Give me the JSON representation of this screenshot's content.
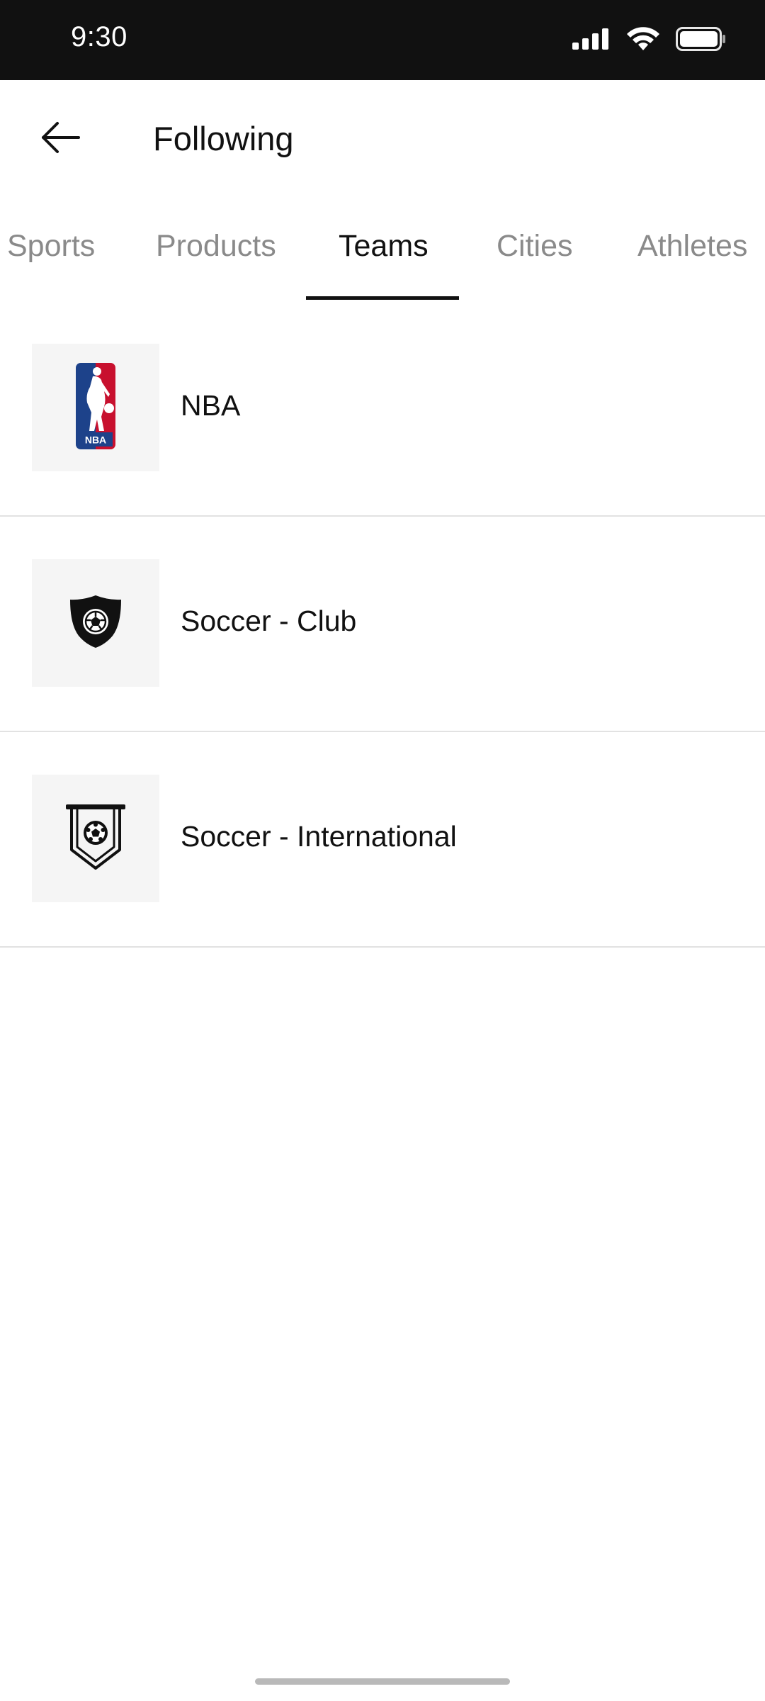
{
  "status_bar": {
    "time": "9:30",
    "icons": [
      "signal-icon",
      "wifi-icon",
      "battery-icon"
    ]
  },
  "header": {
    "title": "Following",
    "back_icon": "arrow-left-icon"
  },
  "tabs": [
    {
      "label": "Sports",
      "active": false
    },
    {
      "label": "Products",
      "active": false
    },
    {
      "label": "Teams",
      "active": true
    },
    {
      "label": "Cities",
      "active": false
    },
    {
      "label": "Athletes",
      "active": false
    }
  ],
  "items": [
    {
      "label": "NBA",
      "icon": "nba-logo-icon"
    },
    {
      "label": "Soccer - Club",
      "icon": "soccer-club-shield-icon"
    },
    {
      "label": "Soccer - International",
      "icon": "soccer-pennant-icon"
    }
  ],
  "colors": {
    "status_bar_bg": "#111111",
    "text_primary": "#111111",
    "text_inactive": "#8a8a8a",
    "thumb_bg": "#f5f5f5",
    "divider": "#e2e2e2",
    "nba_blue": "#1d428a",
    "nba_red": "#c8102e"
  }
}
